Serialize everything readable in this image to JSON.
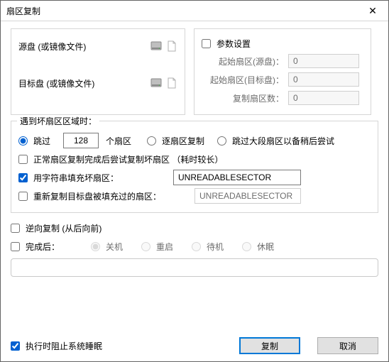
{
  "title": "扇区复制",
  "close_glyph": "✕",
  "left_panel": {
    "source_label": "源盘 (或镜像文件)",
    "target_label": "目标盘 (或镜像文件)"
  },
  "params": {
    "title": "参数设置",
    "start_src_label": "起始扇区(源盘)：",
    "start_src_value": "0",
    "start_tgt_label": "起始扇区(目标盘)：",
    "start_tgt_value": "0",
    "count_label": "复制扇区数：",
    "count_value": "0"
  },
  "bad": {
    "legend": "遇到坏扇区区域时：",
    "skip_label": "跳过",
    "skip_value": "128",
    "skip_unit": "个扇区",
    "per_sector_label": "逐扇区复制",
    "jump_big_label": "跳过大段扇区以备稍后尝试",
    "retry_after_label": "正常扇区复制完成后尝试复制坏扇区 （耗时较长）",
    "fill_label": "用字符串填充坏扇区：",
    "fill_value": "UNREADABLESECTOR",
    "refill_label": "重新复制目标盘被填充过的扇区：",
    "refill_value": "UNREADABLESECTOR"
  },
  "reverse_label": "逆向复制 (从后向前)",
  "after": {
    "label": "完成后：",
    "shutdown": "关机",
    "restart": "重启",
    "standby": "待机",
    "hibernate": "休眠"
  },
  "footer": {
    "prevent_sleep": "执行时阻止系统睡眠",
    "copy_btn": "复制",
    "cancel_btn": "取消"
  }
}
